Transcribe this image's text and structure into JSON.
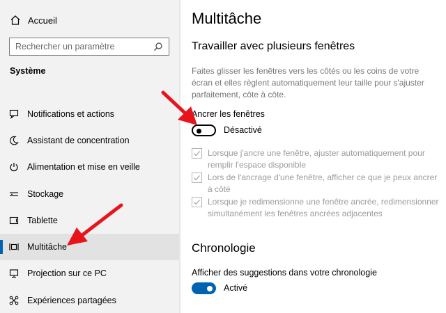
{
  "sidebar": {
    "home_label": "Accueil",
    "search_placeholder": "Rechercher un paramètre",
    "section_title": "Système",
    "items": [
      {
        "label": "Notifications et actions",
        "icon": "notifications-icon"
      },
      {
        "label": "Assistant de concentration",
        "icon": "moon-icon"
      },
      {
        "label": "Alimentation et mise en veille",
        "icon": "power-icon"
      },
      {
        "label": "Stockage",
        "icon": "storage-icon"
      },
      {
        "label": "Tablette",
        "icon": "tablet-icon"
      },
      {
        "label": "Multitâche",
        "icon": "multitasking-icon",
        "active": true
      },
      {
        "label": "Projection sur ce PC",
        "icon": "projection-icon"
      },
      {
        "label": "Expériences partagées",
        "icon": "shared-experiences-icon"
      }
    ]
  },
  "main": {
    "title": "Multitâche",
    "windows_section": {
      "title": "Travailler avec plusieurs fenêtres",
      "description": "Faites glisser les fenêtres vers les côtés ou les coins de votre écran et elles règlent automatiquement leur taille pour s'ajuster parfaitement, côte à côte.",
      "snap_label": "Ancrer les fenêtres",
      "snap_state": "Désactivé",
      "snap_on": false,
      "options": [
        {
          "text": "Lorsque j'ancre une fenêtre, ajuster automatiquement pour remplir l'espace disponible",
          "checked": true
        },
        {
          "text": "Lors de l'ancrage d'une fenêtre, afficher ce que je peux ancrer à côté",
          "checked": true
        },
        {
          "text": "Lorsque je redimensionne une fenêtre ancrée, redimensionner simultanément les fenêtres ancrées adjacentes",
          "checked": true
        }
      ]
    },
    "timeline_section": {
      "title": "Chronologie",
      "suggestions_label": "Afficher des suggestions dans votre chronologie",
      "suggestions_state": "Activé",
      "suggestions_on": true
    }
  },
  "colors": {
    "accent": "#0063b1",
    "annotation_arrow": "#e8141c",
    "sidebar_bg": "#f2f2f2",
    "active_item_bg": "#e2e2e2"
  }
}
